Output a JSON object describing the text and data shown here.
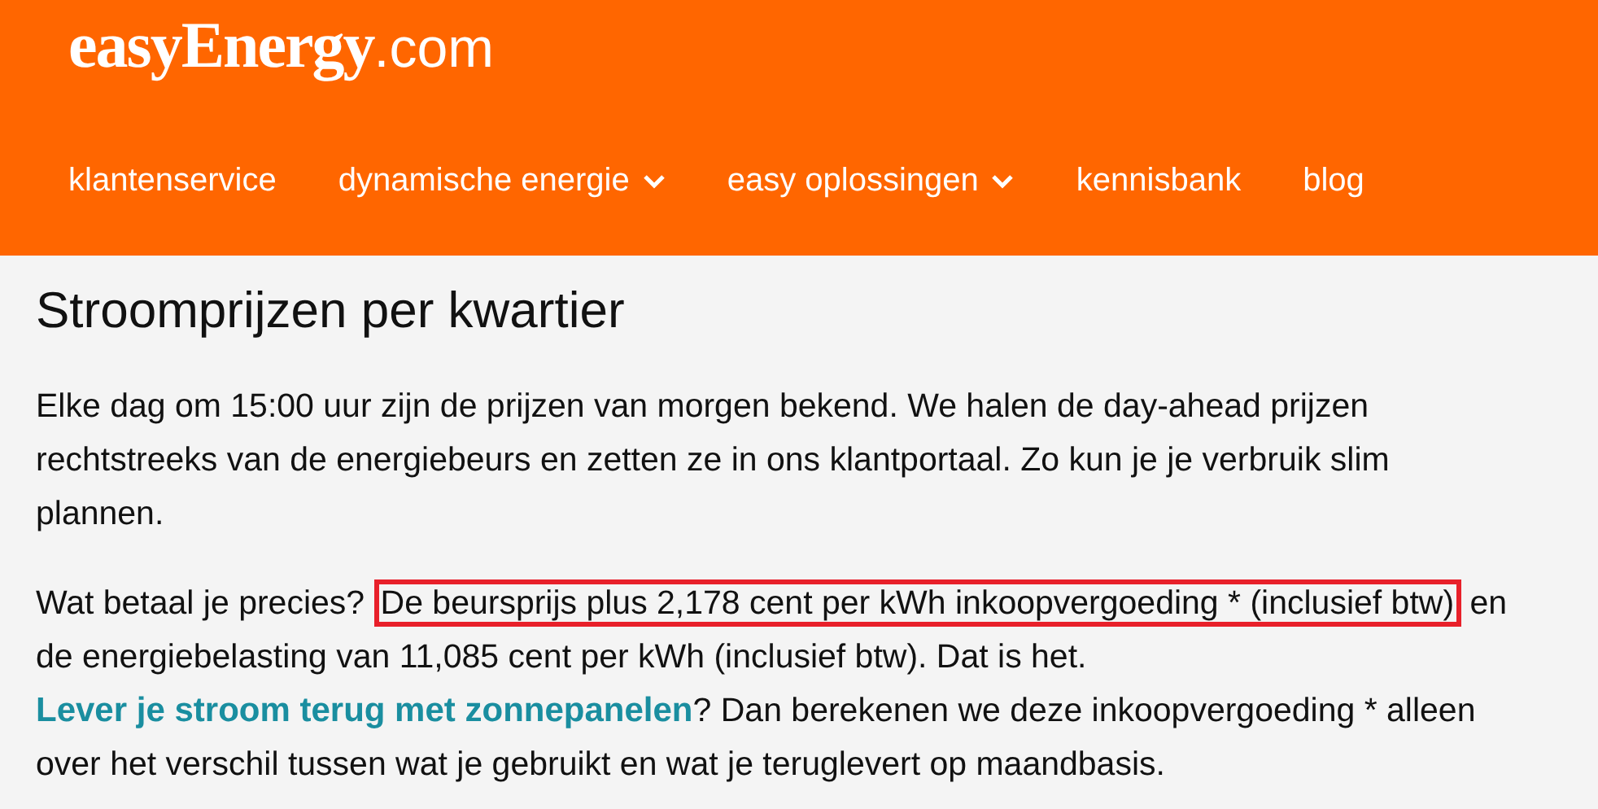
{
  "logo": {
    "name": "easyEnergy",
    "domain": ".com"
  },
  "nav": [
    {
      "label": "klantenservice",
      "has_dropdown": false
    },
    {
      "label": "dynamische energie",
      "has_dropdown": true
    },
    {
      "label": "easy oplossingen",
      "has_dropdown": true
    },
    {
      "label": "kennisbank",
      "has_dropdown": false
    },
    {
      "label": "blog",
      "has_dropdown": false
    }
  ],
  "title": "Stroomprijzen per kwartier",
  "paragraphs": [
    {
      "parts": [
        {
          "kind": "text",
          "text": "Elke dag om 15:00 uur zijn de prijzen van morgen bekend. We halen de day-ahead prijzen rechtstreeks van de energiebeurs en zetten ze in ons klantportaal. Zo kun je je verbruik slim plannen."
        }
      ]
    },
    {
      "parts": [
        {
          "kind": "text",
          "text": "Wat betaal je precies? "
        },
        {
          "kind": "highlight",
          "text": "De beursprijs plus 2,178 cent per kWh inkoopvergoeding * (inclusief btw)"
        },
        {
          "kind": "text",
          "text": " en de energiebelasting van 11,085 cent per kWh (inclusief btw). Dat is het. "
        },
        {
          "kind": "link",
          "text": "Lever je stroom terug met zonnepanelen"
        },
        {
          "kind": "text",
          "text": "? Dan berekenen we deze inkoopvergoeding * alleen over het verschil tussen wat je gebruikt en wat je teruglevert op maandbasis."
        }
      ]
    }
  ]
}
